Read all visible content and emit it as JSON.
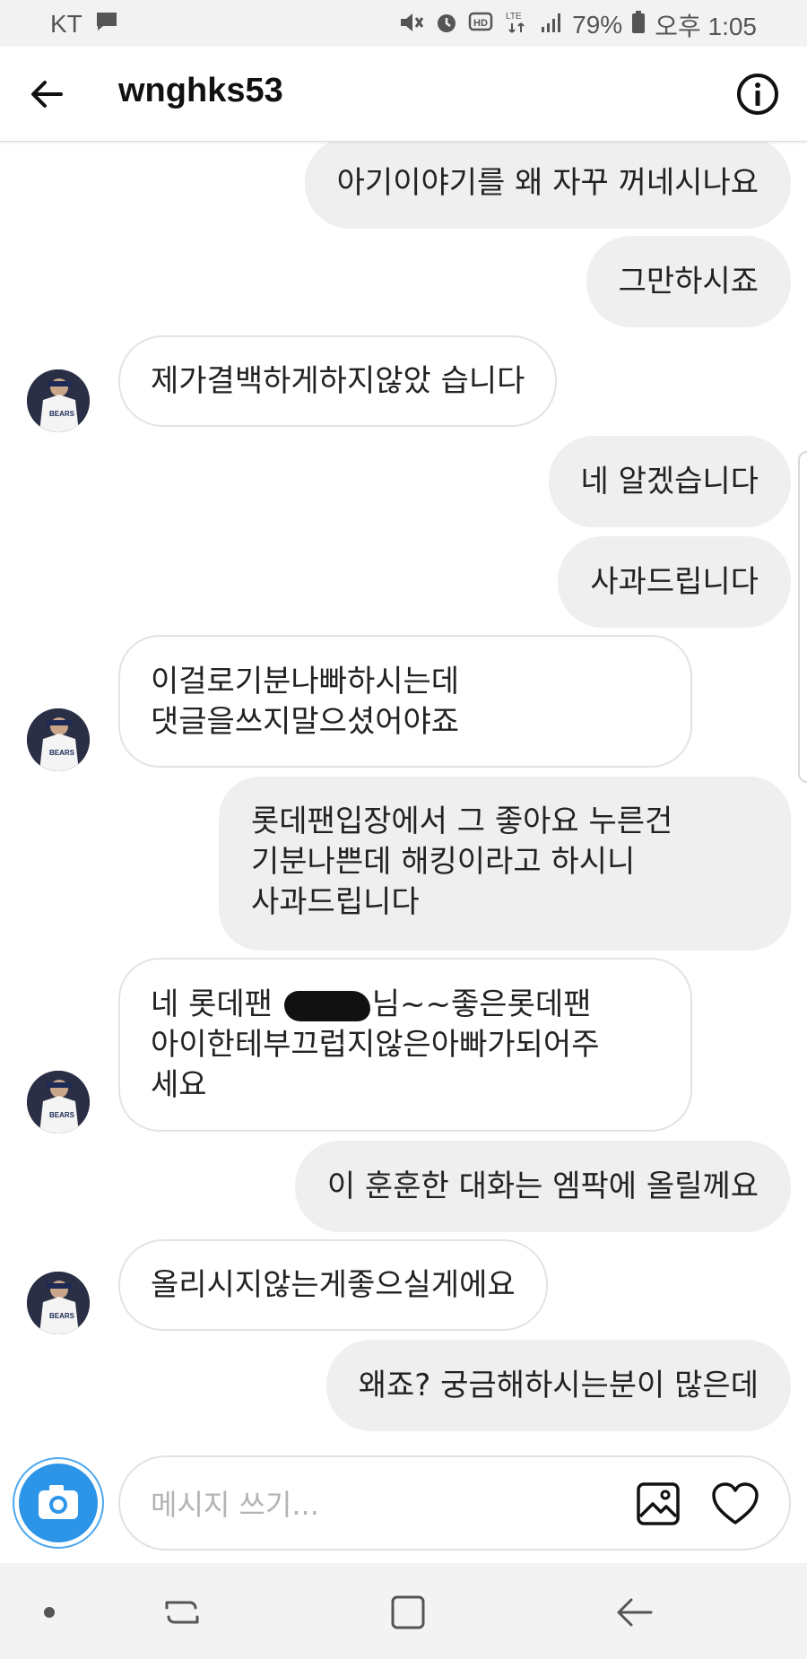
{
  "status_bar": {
    "carrier": "KT",
    "battery": "79%",
    "time": "오후 1:05",
    "network": "LTE",
    "icons": [
      "message-icon",
      "mute-icon",
      "alarm-icon",
      "hd-icon",
      "lte-icon",
      "signal-icon",
      "battery-icon"
    ]
  },
  "header": {
    "title": "wnghks53",
    "back_icon": "arrow-left-icon",
    "info_icon": "info-icon"
  },
  "messages": [
    {
      "from": "me",
      "text": "아기이야기를 왜 자꾸 꺼네시나요"
    },
    {
      "from": "me",
      "text": "그만하시죠"
    },
    {
      "from": "them",
      "text": "제가결백하게하지않았 습니다"
    },
    {
      "from": "me",
      "text": "네 알겠습니다"
    },
    {
      "from": "me",
      "text": "사과드립니다"
    },
    {
      "from": "them",
      "lines": [
        "이걸로기분나빠하시는데",
        "댓글을쓰지말으셨어야죠"
      ]
    },
    {
      "from": "me",
      "lines": [
        "롯데팬입장에서 그 좋아요 누른건",
        "기분나쁜데 해킹이라고 하시니",
        "사과드립니다"
      ]
    },
    {
      "from": "them",
      "lines_before_redaction": "네 롯데팬 ",
      "line1_after_redaction": "님~~좋은롯데팬",
      "lines": [
        "아이한테부끄럽지않은아빠가되어주",
        "세요"
      ]
    },
    {
      "from": "me",
      "text": "이 훈훈한 대화는 엠팍에 올릴께요"
    },
    {
      "from": "them",
      "text": "올리시지않는게좋으실게에요"
    },
    {
      "from": "me",
      "text": "왜죠? 궁금해하시는분이 많은데"
    }
  ],
  "composer": {
    "placeholder": "메시지 쓰기...",
    "camera_icon": "camera-icon",
    "gallery_icon": "gallery-icon",
    "heart_icon": "heart-icon"
  },
  "navbar": {
    "items": [
      "dot-icon",
      "recent-apps-icon",
      "home-icon",
      "back-icon"
    ]
  },
  "colors": {
    "outgoing_bubble": "#efefef",
    "incoming_border": "#e3e3e3",
    "camera_button": "#2d95e8",
    "nav_background": "#f3f3f3"
  }
}
